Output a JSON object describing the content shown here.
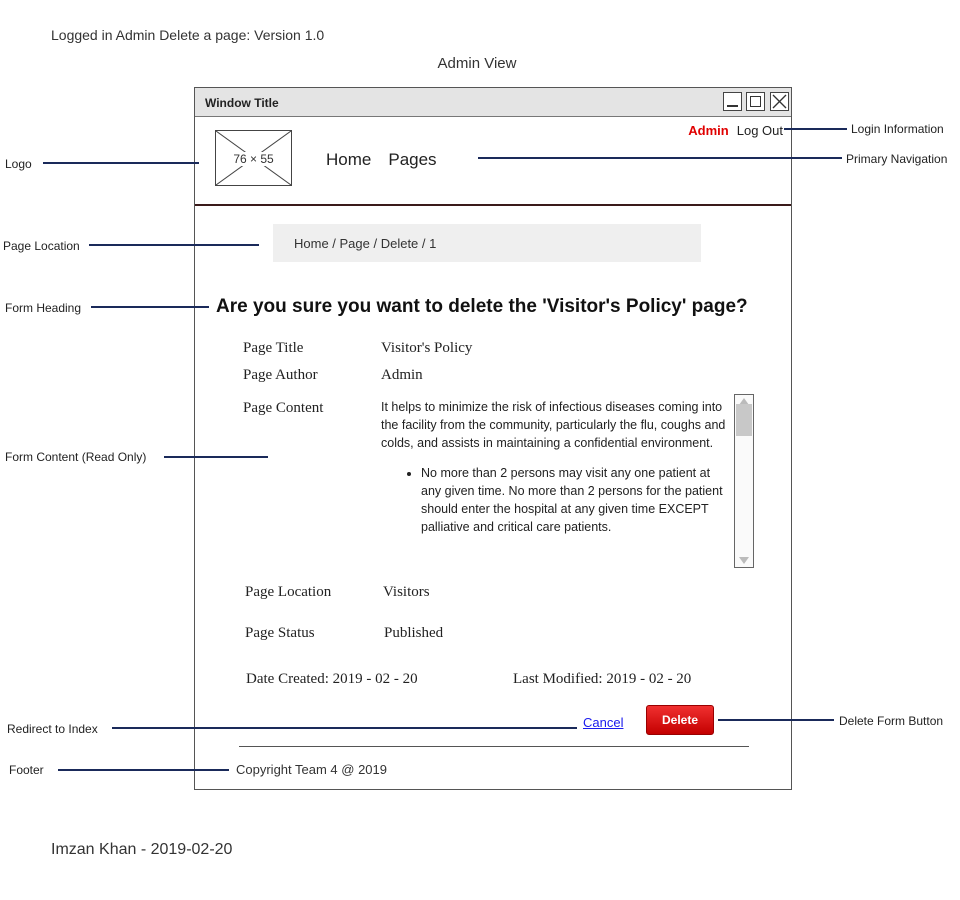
{
  "document": {
    "title": "Logged in Admin Delete a page: Version 1.0",
    "view_title": "Admin View",
    "signature": "Imzan Khan - 2019-02-20"
  },
  "window": {
    "title": "Window Title"
  },
  "logo": {
    "label": "76 × 55"
  },
  "nav": {
    "home": "Home",
    "pages": "Pages"
  },
  "login": {
    "user": "Admin",
    "logout": "Log Out"
  },
  "breadcrumb": "Home / Page / Delete / 1",
  "form": {
    "heading": "Are you sure you want to delete the 'Visitor's Policy' page?",
    "title_label": "Page Title",
    "title_value": "Visitor's Policy",
    "author_label": "Page Author",
    "author_value": "Admin",
    "content_label": "Page Content",
    "content_paragraph": "It helps to minimize the risk of infectious diseases coming into the facility from the community, particularly the flu, coughs and colds, and assists in maintaining a confidential environment.",
    "content_bullet": "No more than 2 persons may visit any one patient at any given time.  No more than 2 persons for the patient should enter the hospital at any given time EXCEPT palliative and critical care patients.",
    "location_label": "Page Location",
    "location_value": "Visitors",
    "status_label": "Page Status",
    "status_value": "Published",
    "date_created": "Date Created: 2019 - 02 - 20",
    "last_modified": "Last Modified: 2019 - 02 - 20",
    "cancel_label": "Cancel",
    "delete_label": "Delete"
  },
  "footer": "Copyright Team 4 @ 2019",
  "annotations": {
    "logo": "Logo",
    "page_location": "Page Location",
    "form_heading": "Form Heading",
    "form_content": "Form Content (Read Only)",
    "redirect": "Redirect to Index",
    "footer": "Footer",
    "login_information": "Login Information",
    "primary_navigation": "Primary Navigation",
    "delete_button": "Delete Form Button"
  },
  "colors": {
    "admin": "#e00000",
    "delete_button": "#e01010",
    "link": "#1a1aee",
    "annotation_line": "#1a2a5a"
  }
}
